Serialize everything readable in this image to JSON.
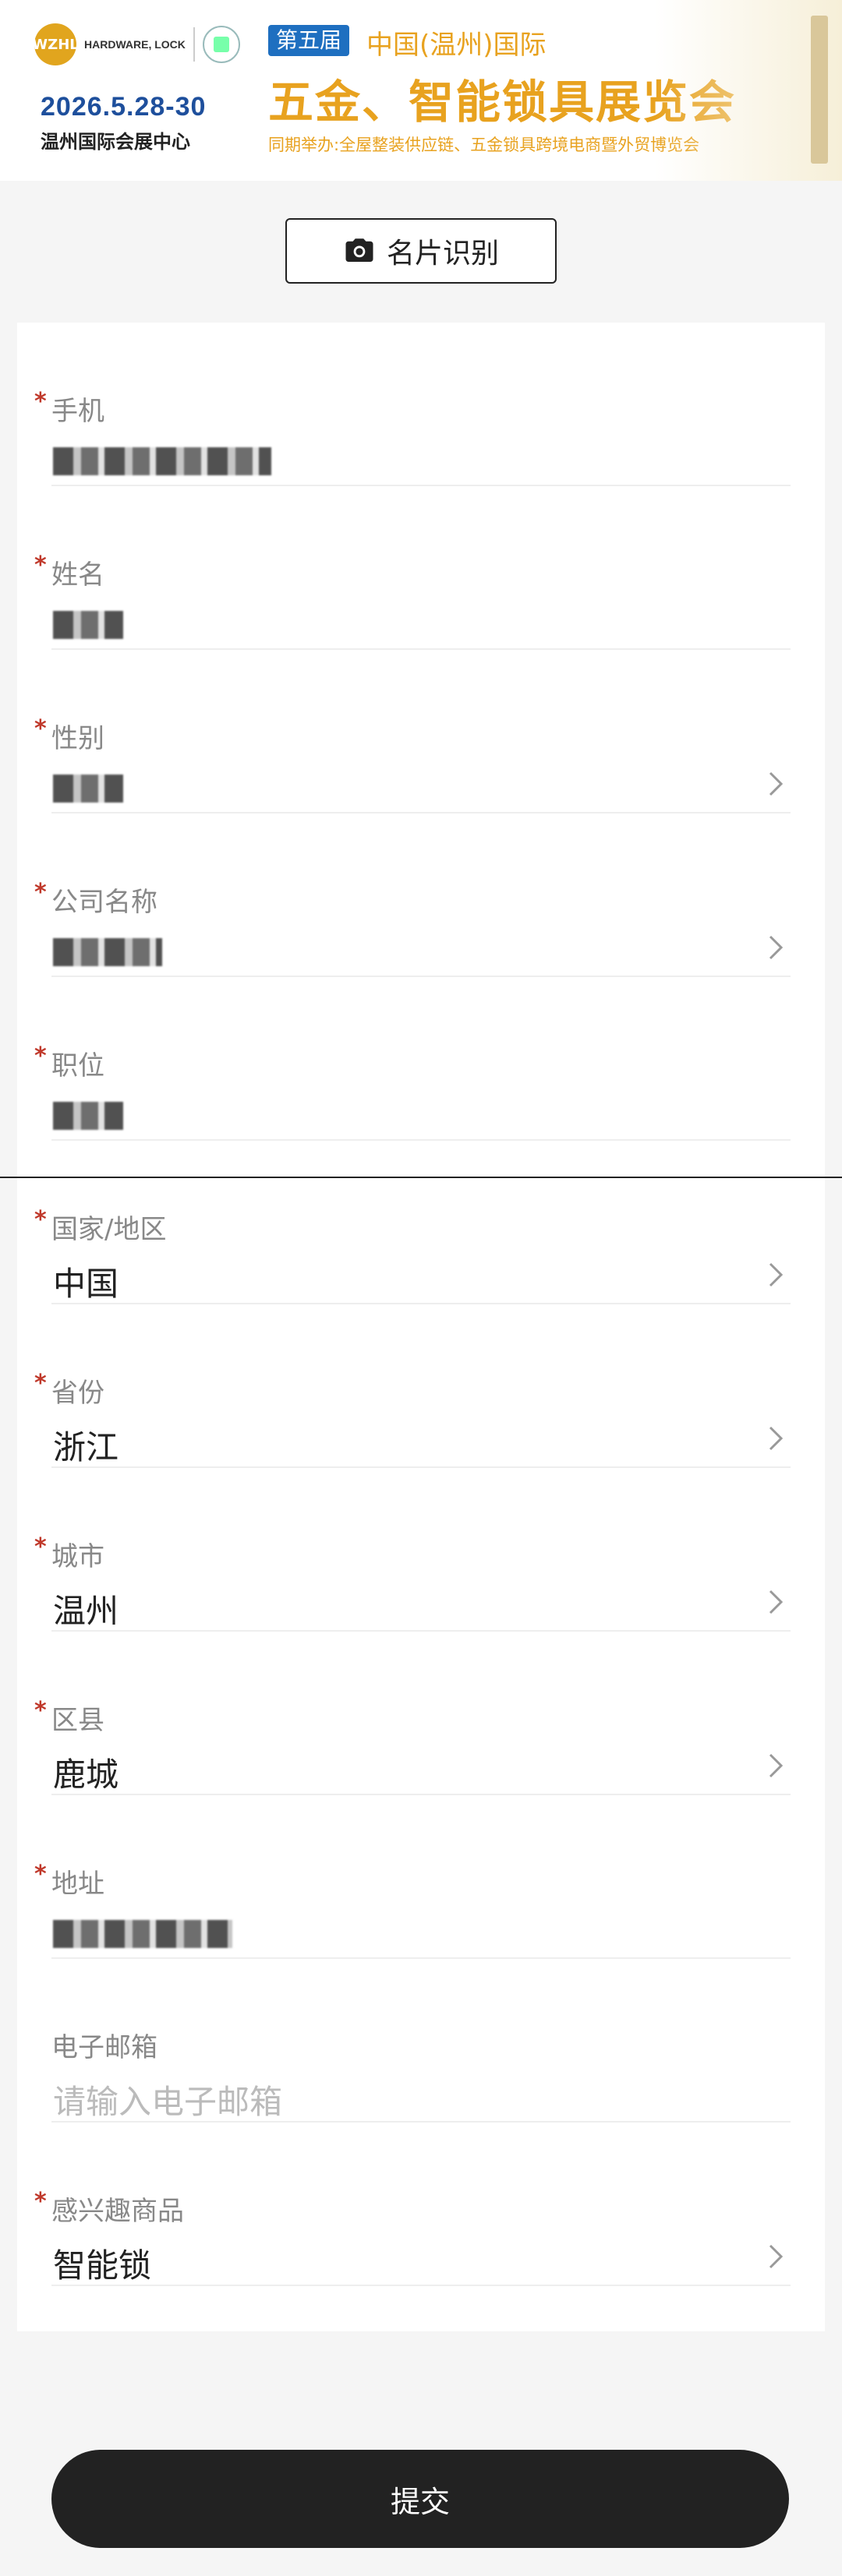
{
  "banner": {
    "logo_text": "WZHL",
    "logo_sub": "HARDWARE, LOCK",
    "date": "2026.5.28-30",
    "venue": "温州国际会展中心",
    "edition": "第五届",
    "region": "中国(温州)国际",
    "title": "五金、智能锁具展览会",
    "concurrent": "同期举办:全屋整装供应链、五金锁具跨境电商暨外贸博览会"
  },
  "scan_button": {
    "label": "名片识别",
    "icon": "camera-icon"
  },
  "fields": [
    {
      "label": "手机",
      "required": true,
      "value": "",
      "redacted": true,
      "has_chevron": false
    },
    {
      "label": "姓名",
      "required": true,
      "value": "",
      "redacted": true,
      "has_chevron": false
    },
    {
      "label": "性别",
      "required": true,
      "value": "",
      "redacted": true,
      "has_chevron": true
    },
    {
      "label": "公司名称",
      "required": true,
      "value": "",
      "redacted": true,
      "has_chevron": true
    },
    {
      "label": "职位",
      "required": true,
      "value": "",
      "redacted": true,
      "has_chevron": false
    },
    {
      "label": "国家/地区",
      "required": true,
      "value": "中国",
      "has_chevron": true
    },
    {
      "label": "省份",
      "required": true,
      "value": "浙江",
      "has_chevron": true
    },
    {
      "label": "城市",
      "required": true,
      "value": "温州",
      "has_chevron": true
    },
    {
      "label": "区县",
      "required": true,
      "value": "鹿城",
      "has_chevron": true
    },
    {
      "label": "地址",
      "required": true,
      "value": "",
      "redacted": true,
      "has_chevron": false
    },
    {
      "label": "电子邮箱",
      "required": false,
      "placeholder": "请输入电子邮箱",
      "has_chevron": false
    },
    {
      "label": "感兴趣商品",
      "required": true,
      "value": "智能锁",
      "has_chevron": true
    }
  ],
  "required_mark": "*",
  "submit_label": "提交",
  "colors": {
    "accent": "#e8a21f",
    "brand_blue": "#1e4f9c",
    "required": "#c0392b",
    "button": "#222222"
  }
}
